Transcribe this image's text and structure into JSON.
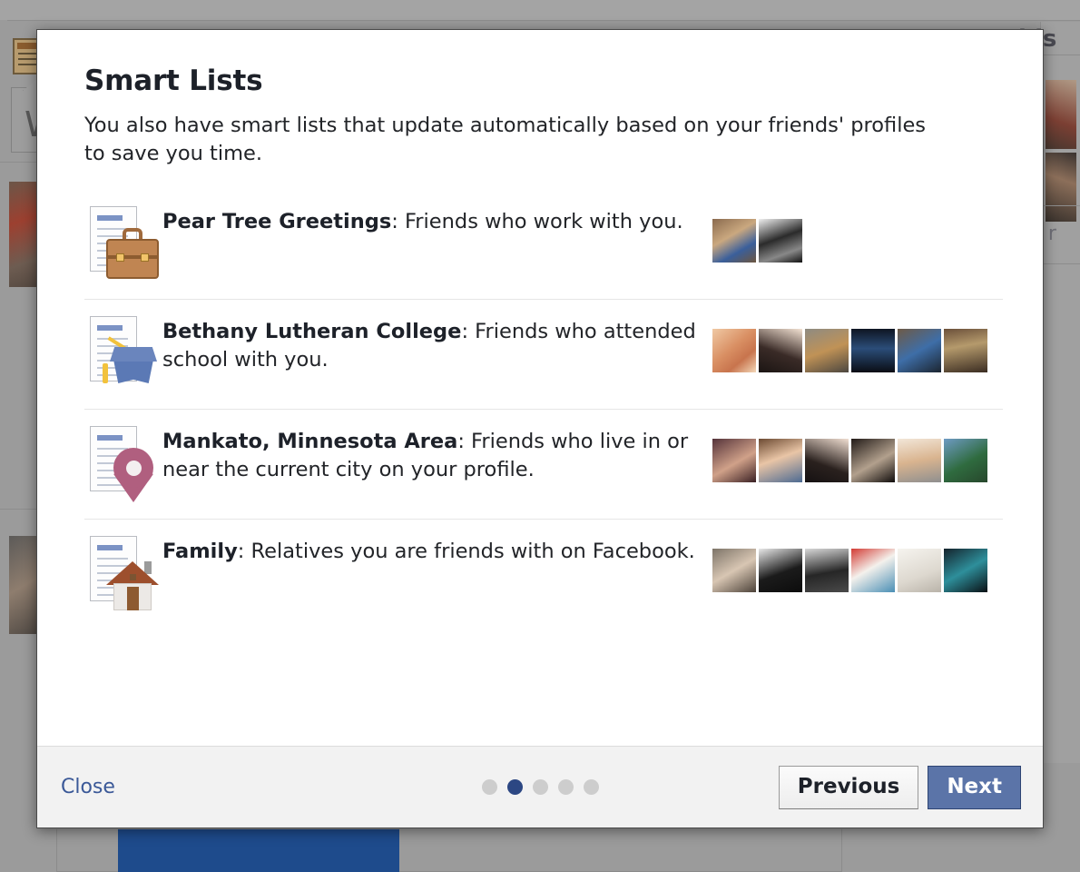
{
  "background": {
    "text_right_partial": "his",
    "text_add_partial": "dd r",
    "box_letter": "W",
    "blue_block_ghost_text": ""
  },
  "modal": {
    "title": "Smart Lists",
    "subtitle": "You also have smart lists that update automatically based on your friends' profiles to save you time.",
    "rows": [
      {
        "icon": "document-briefcase-icon",
        "name": "Pear Tree Greetings",
        "separator": ": ",
        "description": "Friends who work with you.",
        "thumb_count": 2,
        "thumbs": [
          {
            "label": "friend-thumbnail-1",
            "color": "linear-gradient(150deg,#8a6a4e,#caa87f 40%,#3a5f9b 70%,#6d563f)"
          },
          {
            "label": "friend-thumbnail-2",
            "color": "linear-gradient(160deg,#efefef,#2b2b2b 45%,#888 75%,#111)"
          }
        ]
      },
      {
        "icon": "document-graduation-cap-icon",
        "name": "Bethany Lutheran College",
        "separator": ": ",
        "description": "Friends who attended school with you.",
        "thumb_count": 6,
        "thumbs": [
          {
            "label": "friend-thumbnail-1",
            "color": "linear-gradient(140deg,#f0c9a4,#d98f63 45%,#c8744d 70%,#f3d7b8)"
          },
          {
            "label": "friend-thumbnail-2",
            "color": "linear-gradient(200deg,#f3e2d3,#3a2b27 55%,#1b1513)"
          },
          {
            "label": "friend-thumbnail-3",
            "color": "linear-gradient(160deg,#8e8b82,#c09256 50%,#4c4740)"
          },
          {
            "label": "friend-thumbnail-4",
            "color": "linear-gradient(180deg,#0e1522,#2b4d79 45%,#0a0d14)"
          },
          {
            "label": "friend-thumbnail-5",
            "color": "linear-gradient(150deg,#6e5a46,#3e6ea8 50%,#1c2530)"
          },
          {
            "label": "friend-thumbnail-6",
            "color": "linear-gradient(170deg,#6b503a,#b59a6c 40%,#3b2d22)"
          }
        ]
      },
      {
        "icon": "document-map-pin-icon",
        "name": "Mankato, Minnesota Area",
        "separator": ": ",
        "description": "Friends who live in or near the current city on your profile.",
        "thumb_count": 6,
        "thumbs": [
          {
            "label": "friend-thumbnail-1",
            "color": "linear-gradient(150deg,#55333a,#d0a189 55%,#3a2024)"
          },
          {
            "label": "friend-thumbnail-2",
            "color": "linear-gradient(160deg,#6c4a32,#e9c5a6 45%,#4c6a92)"
          },
          {
            "label": "friend-thumbnail-3",
            "color": "linear-gradient(200deg,#f0ded1,#2a211e 60%,#151112)"
          },
          {
            "label": "friend-thumbnail-4",
            "color": "linear-gradient(150deg,#221b18,#b2a08d 55%,#100c0b)"
          },
          {
            "label": "friend-thumbnail-5",
            "color": "linear-gradient(170deg,#f2e6d8,#d9b48f 50%,#8f8f8f)"
          },
          {
            "label": "friend-thumbnail-6",
            "color": "linear-gradient(150deg,#6e9bc4,#2f6b3f 55%,#27472c)"
          }
        ]
      },
      {
        "icon": "document-house-icon",
        "name": "Family",
        "separator": ": ",
        "description": "Relatives you are friends with on Facebook.",
        "thumb_count": 6,
        "thumbs": [
          {
            "label": "friend-thumbnail-1",
            "color": "linear-gradient(150deg,#7d7468,#d8c6b3 50%,#4c4239)"
          },
          {
            "label": "friend-thumbnail-2",
            "color": "linear-gradient(160deg,#e8e8e8,#1b1b1b 55%,#0c0c0c)"
          },
          {
            "label": "friend-thumbnail-3",
            "color": "linear-gradient(170deg,#d7d7d7,#262626 55%,#4a4a4a)"
          },
          {
            "label": "friend-thumbnail-4",
            "color": "linear-gradient(150deg,#d23b34,#f4f1ec 45%,#4a8fb5)"
          },
          {
            "label": "friend-thumbnail-5",
            "color": "linear-gradient(160deg,#f6f4ef,#ddd8cf 60%,#b9b3a9)"
          },
          {
            "label": "friend-thumbnail-6",
            "color": "linear-gradient(150deg,#14222b,#2e8f9b 50%,#0a1014)"
          }
        ]
      }
    ]
  },
  "footer": {
    "close_label": "Close",
    "previous_label": "Previous",
    "next_label": "Next",
    "step_count": 5,
    "active_step": 2,
    "accent_active_dot": "#2c4783",
    "accent_next_button": "#5b74a8",
    "accent_link": "#3b5998"
  }
}
